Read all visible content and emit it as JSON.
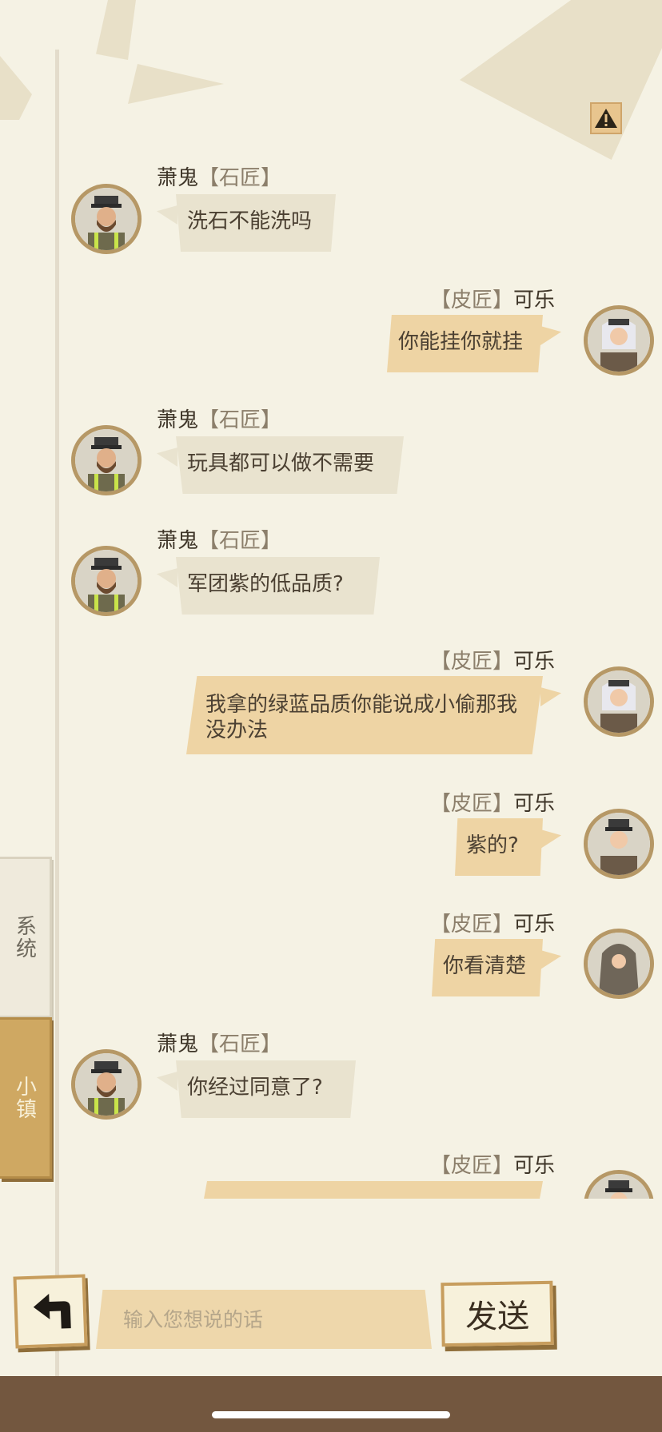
{
  "tabs": {
    "system": "系统",
    "town": "小镇"
  },
  "messages": [
    {
      "side": "left",
      "name": "萧鬼",
      "role": "【石匠】",
      "text": "洗石不能洗吗",
      "avatar": "mason-avatar"
    },
    {
      "side": "right",
      "name": "可乐",
      "role": "【皮匠】",
      "text": "你能挂你就挂",
      "avatar": "tanner-avatar"
    },
    {
      "side": "left",
      "name": "萧鬼",
      "role": "【石匠】",
      "text": "玩具都可以做不需要",
      "avatar": "mason-avatar"
    },
    {
      "side": "left",
      "name": "萧鬼",
      "role": "【石匠】",
      "text": "军团紫的低品质?",
      "avatar": "mason-avatar"
    },
    {
      "side": "right",
      "name": "可乐",
      "role": "【皮匠】",
      "text": "我拿的绿蓝品质你能说成小偷那我没办法",
      "avatar": "tanner-avatar"
    },
    {
      "side": "right",
      "name": "可乐",
      "role": "【皮匠】",
      "text": "紫的?",
      "avatar": "tanner-avatar"
    },
    {
      "side": "right",
      "name": "可乐",
      "role": "【皮匠】",
      "text": "你看清楚",
      "avatar": "hooded-avatar"
    },
    {
      "side": "left",
      "name": "萧鬼",
      "role": "【石匠】",
      "text": "你经过同意了?",
      "avatar": "mason-avatar"
    },
    {
      "side": "right",
      "name": "可乐",
      "role": "【皮匠】",
      "text": "",
      "avatar": "tanner-avatar"
    }
  ],
  "input": {
    "placeholder": "输入您想说的话",
    "value": ""
  },
  "buttons": {
    "send": "发送"
  },
  "icons": {
    "warning": "warning-icon",
    "back": "back-arrow-icon"
  },
  "colors": {
    "background": "#f5f2e4",
    "left_bubble": "#e9e3cf",
    "right_bubble": "#eed4a4",
    "accent": "#c79d5d",
    "bottom_bar": "#73573f"
  }
}
